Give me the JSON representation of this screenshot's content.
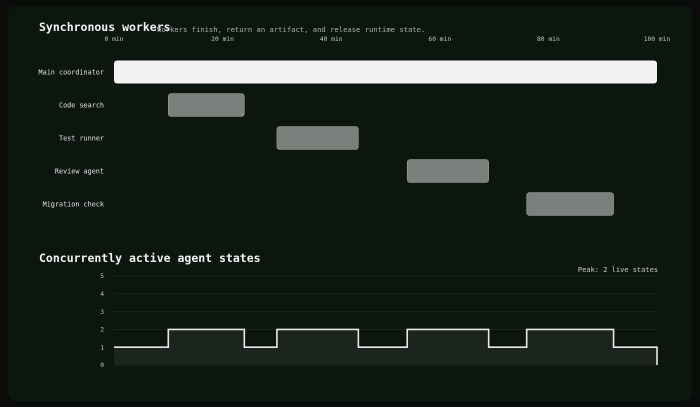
{
  "gantt": {
    "title": "Synchronous workers",
    "subtitle": "Workers finish, return an artifact, and release runtime state."
  },
  "states": {
    "title": "Concurrently active agent states",
    "peak_label": "Peak: 2 live states"
  },
  "colors": {
    "background": "#0c160f",
    "coordinator_bar": "#f2f2f2",
    "worker_bar": "#7c807c",
    "step_line": "#e8e8e8",
    "step_fill": "#1b241d",
    "grid": "#1f2a21"
  },
  "chart_data": [
    {
      "type": "gantt",
      "title": "Synchronous workers",
      "subtitle": "Workers finish, return an artifact, and release runtime state.",
      "x_unit": "min",
      "xlim": [
        0,
        100
      ],
      "x_ticks": [
        0,
        20,
        40,
        60,
        80,
        100
      ],
      "x_tick_labels": [
        "0 min",
        "20 min",
        "40 min",
        "60 min",
        "80 min",
        "100 min"
      ],
      "tasks": [
        {
          "label": "Main coordinator",
          "start": 0,
          "end": 100,
          "kind": "coordinator"
        },
        {
          "label": "Code search",
          "start": 10,
          "end": 24,
          "kind": "worker"
        },
        {
          "label": "Test runner",
          "start": 30,
          "end": 45,
          "kind": "worker"
        },
        {
          "label": "Review agent",
          "start": 54,
          "end": 69,
          "kind": "worker"
        },
        {
          "label": "Migration check",
          "start": 76,
          "end": 92,
          "kind": "worker"
        }
      ]
    },
    {
      "type": "area",
      "title": "Concurrently active agent states",
      "annotation": "Peak: 2 live states",
      "xlim": [
        0,
        100
      ],
      "ylim": [
        0,
        5
      ],
      "y_ticks": [
        0,
        1,
        2,
        3,
        4,
        5
      ],
      "step_points": [
        {
          "x": 0,
          "y": 1
        },
        {
          "x": 10,
          "y": 2
        },
        {
          "x": 24,
          "y": 1
        },
        {
          "x": 30,
          "y": 2
        },
        {
          "x": 45,
          "y": 1
        },
        {
          "x": 54,
          "y": 2
        },
        {
          "x": 69,
          "y": 1
        },
        {
          "x": 76,
          "y": 2
        },
        {
          "x": 92,
          "y": 1
        },
        {
          "x": 100,
          "y": 0
        }
      ],
      "grid": true
    }
  ]
}
